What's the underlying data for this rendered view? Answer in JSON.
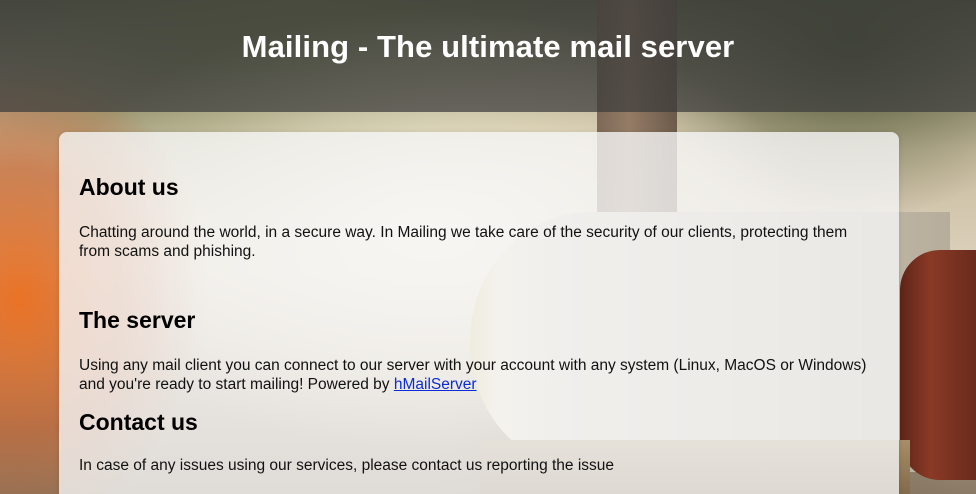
{
  "header": {
    "title": "Mailing - The ultimate mail server"
  },
  "about": {
    "heading": "About us",
    "text": "Chatting around the world, in a secure way. In Mailing we take care of the security of our clients, protecting them from scams and phishing."
  },
  "server": {
    "heading": "The server",
    "text": "Using any mail client you can connect to our server with your account with any system (Linux, MacOS or Windows) and you're ready to start mailing! Powered by ",
    "link_label": "hMailServer"
  },
  "contact": {
    "heading": "Contact us",
    "text": "In case of any issues using our services, please contact us reporting the issue"
  },
  "colors": {
    "header_bg": "#3c3c3c",
    "link": "#0b2bd6",
    "panel_bg": "#f5f5f5"
  }
}
